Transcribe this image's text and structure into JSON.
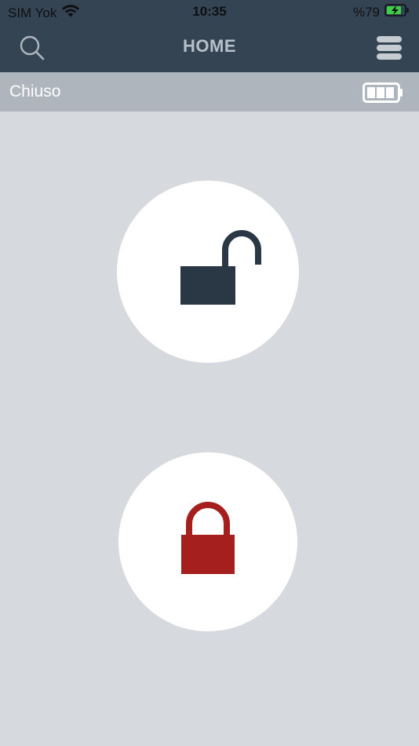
{
  "status_bar": {
    "carrier": "SIM Yok",
    "time": "10:35",
    "battery_percent": "%79",
    "icons": [
      "wifi-icon",
      "battery-charging-icon"
    ]
  },
  "header": {
    "title": "HOME",
    "icons": [
      "search-icon",
      "menu-icon"
    ]
  },
  "state_bar": {
    "label": "Chiuso",
    "battery_icon": "battery-icon",
    "battery_level": 0.75
  },
  "actions": {
    "unlock": {
      "icon": "unlocked-padlock-icon",
      "color": "#2a3846"
    },
    "lock": {
      "icon": "locked-padlock-icon",
      "color": "#a51f1f"
    }
  },
  "colors": {
    "header_bg": "#354452",
    "state_bar_bg": "#aeb5bd",
    "page_bg": "#d6d9dd"
  }
}
